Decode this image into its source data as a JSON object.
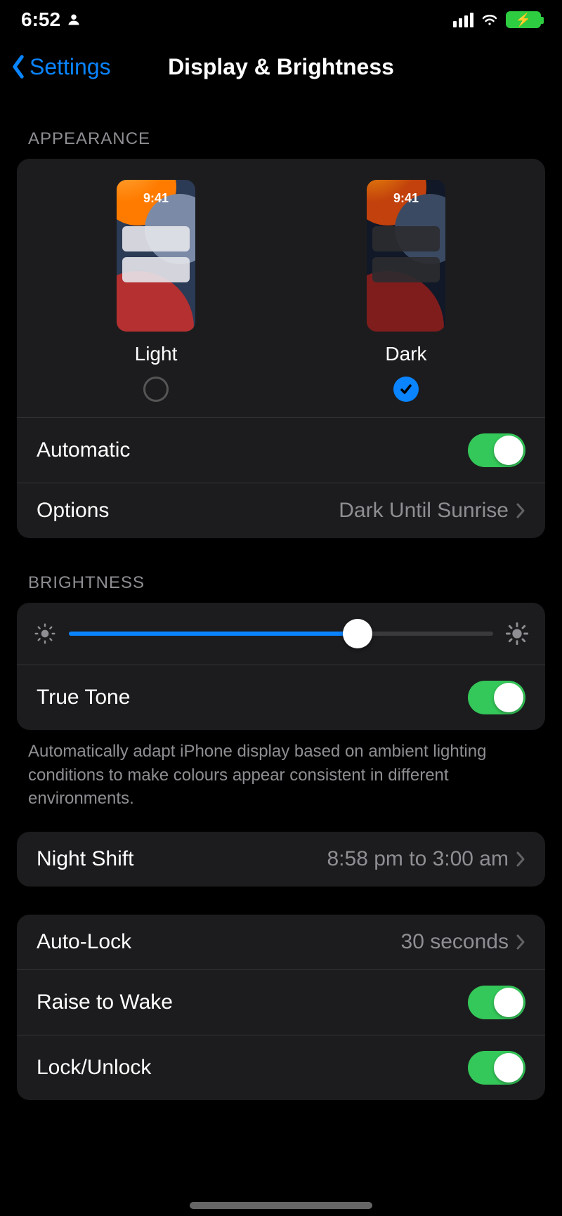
{
  "status": {
    "time": "6:52"
  },
  "nav": {
    "back": "Settings",
    "title": "Display & Brightness"
  },
  "appearance": {
    "section_label": "APPEARANCE",
    "light_label": "Light",
    "dark_label": "Dark",
    "preview_time": "9:41",
    "selected": "dark",
    "automatic_label": "Automatic",
    "automatic_on": true,
    "options_label": "Options",
    "options_value": "Dark Until Sunrise"
  },
  "brightness": {
    "section_label": "BRIGHTNESS",
    "value_percent": 68,
    "truetone_label": "True Tone",
    "truetone_on": true,
    "truetone_footer": "Automatically adapt iPhone display based on ambient lighting conditions to make colours appear consistent in different environments."
  },
  "nightshift": {
    "label": "Night Shift",
    "value": "8:58 pm to 3:00 am"
  },
  "lock": {
    "autolock_label": "Auto-Lock",
    "autolock_value": "30 seconds",
    "raise_label": "Raise to Wake",
    "raise_on": true,
    "lockunlock_label": "Lock/Unlock",
    "lockunlock_on": true
  }
}
